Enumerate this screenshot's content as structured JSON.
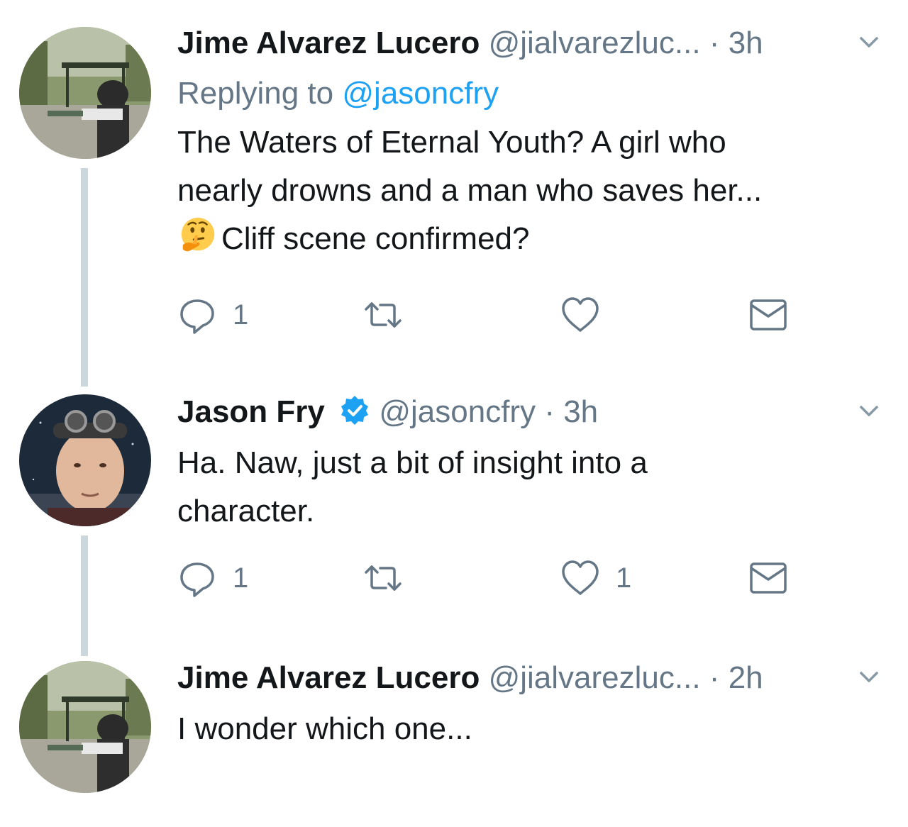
{
  "tweets": [
    {
      "author": "Jime Alvarez Lucero",
      "handle": "@jialvarezluc...",
      "separator": "·",
      "time": "3h",
      "reply_prefix": "Replying to",
      "reply_handle": "@jasoncfry",
      "text_line1": "The Waters of Eternal Youth? A girl who",
      "text_line2": "nearly drowns and a man who saves her...",
      "emoji": "thinking-face-emoji",
      "text_line3": "Cliff scene confirmed?",
      "reply_count": "1",
      "retweet_count": "",
      "like_count": "",
      "avatar": "park-photo-avatar"
    },
    {
      "author": "Jason Fry",
      "verified": true,
      "handle": "@jasoncfry",
      "separator": "·",
      "time": "3h",
      "text": "Ha. Naw, just a bit of insight into a\ncharacter.",
      "reply_count": "1",
      "retweet_count": "",
      "like_count": "1",
      "avatar": "goggles-man-avatar"
    },
    {
      "author": "Jime Alvarez Lucero",
      "handle": "@jialvarezluc...",
      "separator": "·",
      "time": "2h",
      "text": "I wonder which one...",
      "avatar": "park-photo-avatar"
    }
  ],
  "icons": {
    "reply": "reply-icon",
    "retweet": "retweet-icon",
    "like": "heart-icon",
    "dm": "mail-icon",
    "caret": "chevron-down-icon",
    "verified": "verified-badge-icon"
  },
  "colors": {
    "text": "#14171a",
    "secondary": "#657786",
    "link": "#1da1f2",
    "thread_line": "#ccd6dd"
  }
}
